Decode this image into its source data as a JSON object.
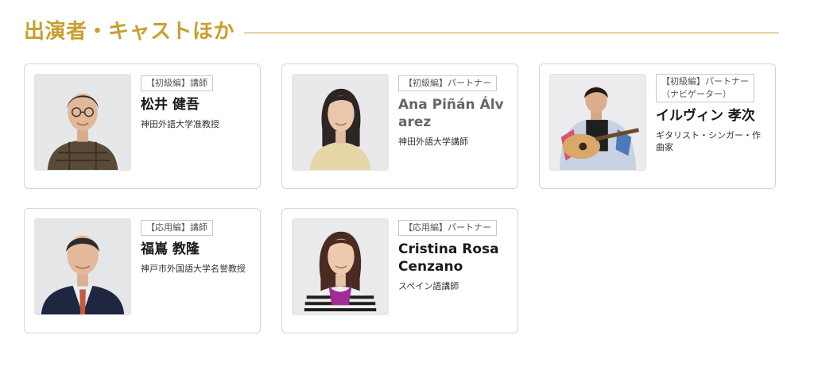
{
  "section": {
    "title": "出演者・キャストほか",
    "accent_color": "#c8a02f"
  },
  "cast": [
    {
      "tag": "【初級編】講師",
      "name": "松井 健吾",
      "role": "神田外語大学准教授",
      "photo_icon": "portrait-man-glasses"
    },
    {
      "tag": "【初級編】パートナー",
      "name": "Ana Piñán Álvarez",
      "role": "神田外語大学講師",
      "photo_icon": "portrait-woman-dark-hair"
    },
    {
      "tag": "【初級編】パートナー（ナビゲーター）",
      "name": "イルヴィン 孝次",
      "role": "ギタリスト・シンガー・作曲家",
      "photo_icon": "portrait-man-guitar"
    },
    {
      "tag": "【応用編】講師",
      "name": "福嶌 教隆",
      "role": "神戸市外国語大学名誉教授",
      "photo_icon": "portrait-man-suit"
    },
    {
      "tag": "【応用編】パートナー",
      "name": "Cristina Rosa Cenzano",
      "role": "スペイン語講師",
      "photo_icon": "portrait-woman-scarf"
    }
  ]
}
